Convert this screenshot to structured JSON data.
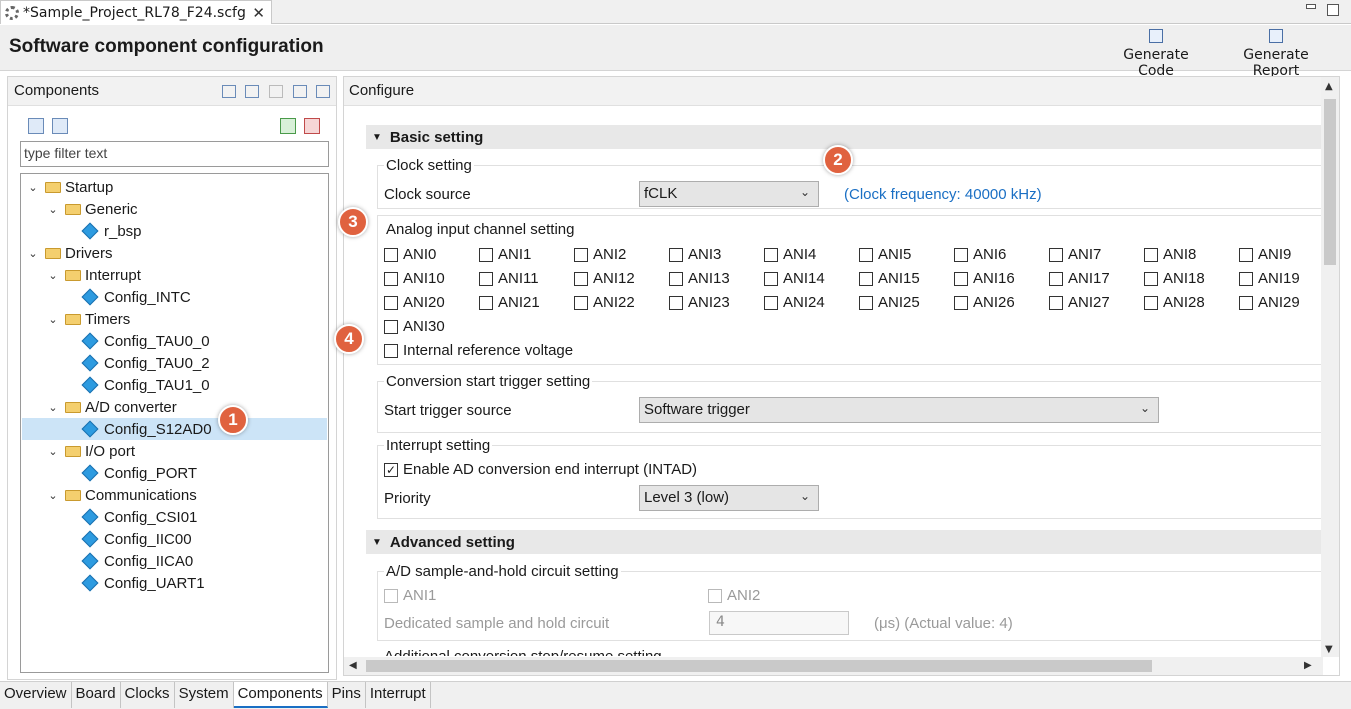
{
  "editor_tab": {
    "title": "*Sample_Project_RL78_F24.scfg",
    "close": "✕"
  },
  "header": {
    "title": "Software component configuration",
    "generate_code": "Generate Code",
    "generate_report": "Generate Report"
  },
  "components": {
    "title": "Components",
    "filter_placeholder": "type filter text",
    "tree": [
      {
        "label": "Startup",
        "type": "folder",
        "level": 0
      },
      {
        "label": "Generic",
        "type": "folder",
        "level": 1
      },
      {
        "label": "r_bsp",
        "type": "item",
        "level": 2
      },
      {
        "label": "Drivers",
        "type": "folder",
        "level": 0
      },
      {
        "label": "Interrupt",
        "type": "folder",
        "level": 1
      },
      {
        "label": "Config_INTC",
        "type": "item",
        "level": 2
      },
      {
        "label": "Timers",
        "type": "folder",
        "level": 1
      },
      {
        "label": "Config_TAU0_0",
        "type": "item",
        "level": 2
      },
      {
        "label": "Config_TAU0_2",
        "type": "item",
        "level": 2
      },
      {
        "label": "Config_TAU1_0",
        "type": "item",
        "level": 2
      },
      {
        "label": "A/D converter",
        "type": "folder",
        "level": 1
      },
      {
        "label": "Config_S12AD0",
        "type": "item",
        "level": 2,
        "selected": true
      },
      {
        "label": "I/O port",
        "type": "folder",
        "level": 1
      },
      {
        "label": "Config_PORT",
        "type": "item",
        "level": 2
      },
      {
        "label": "Communications",
        "type": "folder",
        "level": 1
      },
      {
        "label": "Config_CSI01",
        "type": "item",
        "level": 2
      },
      {
        "label": "Config_IIC00",
        "type": "item",
        "level": 2
      },
      {
        "label": "Config_IICA0",
        "type": "item",
        "level": 2
      },
      {
        "label": "Config_UART1",
        "type": "item",
        "level": 2
      }
    ]
  },
  "configure": {
    "title": "Configure",
    "basic_setting": "Basic setting",
    "clock_setting": "Clock setting",
    "clock_source_label": "Clock source",
    "clock_source_value": "fCLK",
    "clock_frequency": "(Clock frequency: 40000 kHz)",
    "analog_setting": "Analog input channel setting",
    "ani_channels": [
      "ANI0",
      "ANI1",
      "ANI2",
      "ANI3",
      "ANI4",
      "ANI5",
      "ANI6",
      "ANI7",
      "ANI8",
      "ANI9",
      "ANI10",
      "ANI11",
      "ANI12",
      "ANI13",
      "ANI14",
      "ANI15",
      "ANI16",
      "ANI17",
      "ANI18",
      "ANI19",
      "ANI20",
      "ANI21",
      "ANI22",
      "ANI23",
      "ANI24",
      "ANI25",
      "ANI26",
      "ANI27",
      "ANI28",
      "ANI29",
      "ANI30"
    ],
    "internal_ref": "Internal reference voltage",
    "conversion_trigger": "Conversion start trigger setting",
    "start_trigger_label": "Start trigger source",
    "start_trigger_value": "Software trigger",
    "interrupt_setting": "Interrupt setting",
    "enable_interrupt": "Enable AD conversion end interrupt (INTAD)",
    "priority_label": "Priority",
    "priority_value": "Level 3 (low)",
    "advanced_setting": "Advanced setting",
    "sample_hold_setting": "A/D sample-and-hold circuit setting",
    "sh_ani1": "ANI1",
    "sh_ani2": "ANI2",
    "dedicated_label": "Dedicated sample and hold circuit",
    "dedicated_value": "4",
    "dedicated_unit": "(μs) (Actual value: 4)",
    "cut_off_text": "Additional conversion stop/resume setting"
  },
  "callouts": [
    "1",
    "2",
    "3",
    "4"
  ],
  "bottom_tabs": [
    "Overview",
    "Board",
    "Clocks",
    "System",
    "Components",
    "Pins",
    "Interrupt"
  ],
  "active_bottom_tab": "Components",
  "colors": {
    "accent": "#1a6fc4",
    "callout": "#e0623f",
    "selection": "#cce4f7"
  }
}
